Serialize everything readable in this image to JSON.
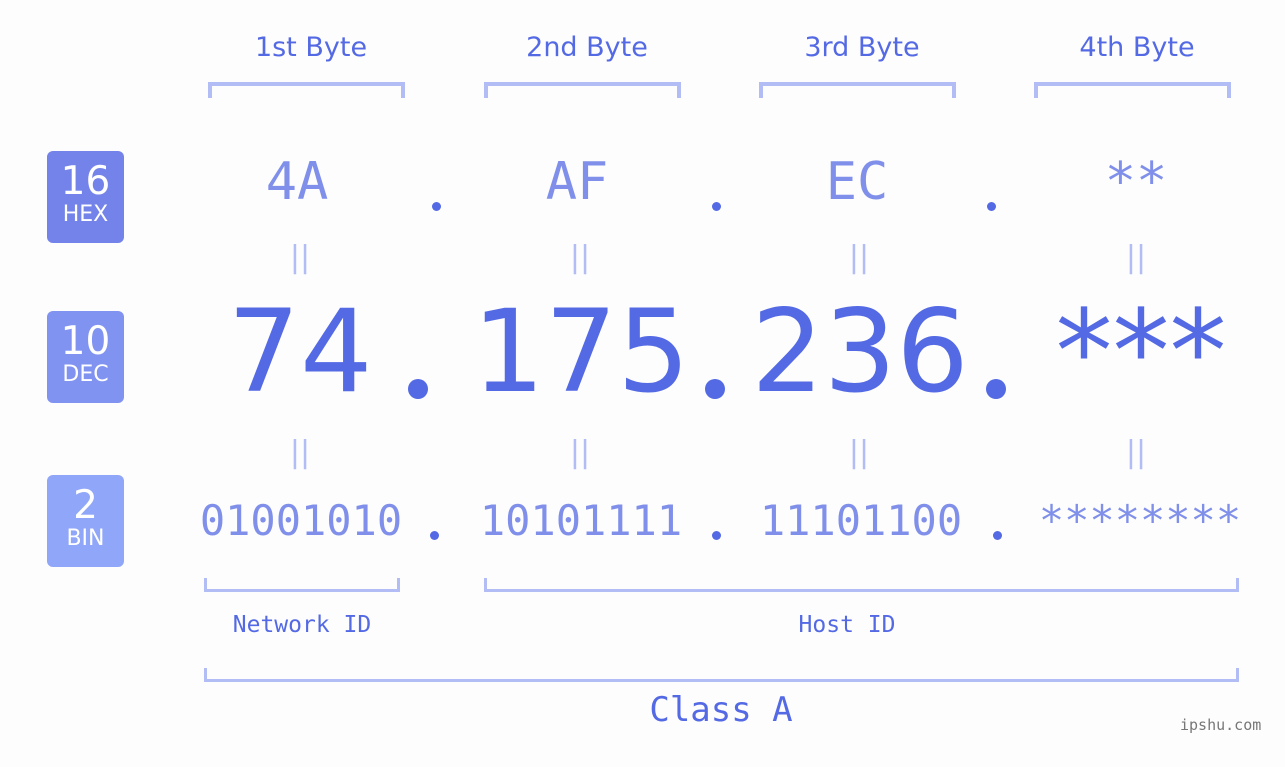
{
  "bytes": {
    "labels": [
      "1st Byte",
      "2nd Byte",
      "3rd Byte",
      "4th Byte"
    ]
  },
  "badges": [
    {
      "num": "16",
      "label": "HEX",
      "color": "#7383ea"
    },
    {
      "num": "10",
      "label": "DEC",
      "color": "#8193f0"
    },
    {
      "num": "2",
      "label": "BIN",
      "color": "#90a6f8"
    }
  ],
  "hex": [
    "4A",
    "AF",
    "EC",
    "**"
  ],
  "dec": [
    "74",
    "175",
    "236",
    "***"
  ],
  "bin": [
    "01001010",
    "10101111",
    "11101100",
    "********"
  ],
  "equals_symbol": "||",
  "segments": {
    "network_label": "Network ID",
    "host_label": "Host ID",
    "class_label": "Class A"
  },
  "watermark": "ipshu.com",
  "colors": {
    "primary": "#5469e4",
    "secondary": "#8090ea",
    "bracket": "#b2bdf6",
    "background": "#fcfdfc"
  }
}
